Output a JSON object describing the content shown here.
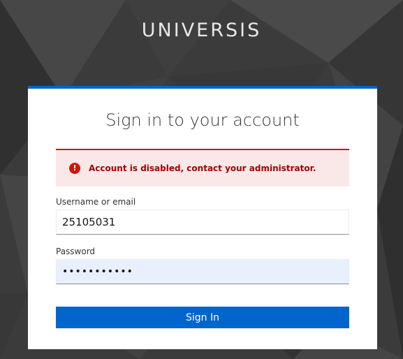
{
  "brand": {
    "name": "UNIVERSIS"
  },
  "login": {
    "title": "Sign in to your account",
    "alert": {
      "icon": "error-icon",
      "message": "Account is disabled, contact your administrator."
    },
    "username": {
      "label": "Username or email",
      "value": "25105031"
    },
    "password": {
      "label": "Password",
      "masked_value": "•••••••••••"
    },
    "submit_label": "Sign In"
  },
  "colors": {
    "accent": "#0066cc",
    "error": "#c9190b",
    "error_bg": "#fae8e8",
    "background": "#3a3a3a"
  }
}
